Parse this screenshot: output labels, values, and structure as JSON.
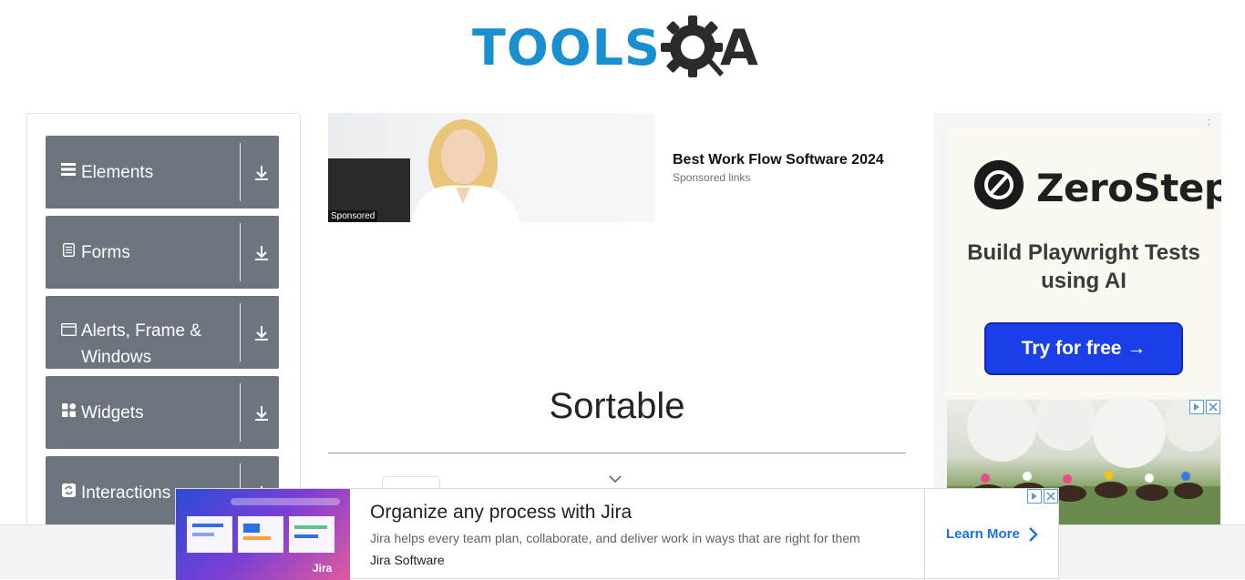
{
  "header": {
    "logo_text": "TOOLS",
    "logo_q_letter": "A",
    "logo_icon": "gear-magnifier-icon",
    "brand_color": "#1a8fd0"
  },
  "sidebar": {
    "groups": [
      {
        "label": "Elements",
        "icon": "hamburger-icon"
      },
      {
        "label": "Forms",
        "icon": "document-icon"
      },
      {
        "label": "Alerts, Frame & Windows",
        "icon": "window-icon"
      },
      {
        "label": "Widgets",
        "icon": "grid-icon"
      },
      {
        "label": "Interactions",
        "icon": "swap-icon"
      }
    ],
    "group_color": "#6c757d"
  },
  "ad_top": {
    "sponsored_tag": "Sponsored",
    "title": "Best Work Flow Software 2024",
    "subtitle": "Sponsored links"
  },
  "main": {
    "page_title": "Sortable"
  },
  "ad_right": {
    "brand": "ZeroStep",
    "tagline": "Build Playwright Tests using AI",
    "cta": "Try for free →",
    "cta_color": "#1a3fe8",
    "corner_marker": ":"
  },
  "ad_bottom": {
    "title": "Organize any process with Jira",
    "description": "Jira helps every team plan, collaborate, and deliver work in ways that are right for them",
    "brand": "Jira Software",
    "image_badge": "Jira",
    "cta": "Learn More",
    "cta_color": "#1a73e8"
  }
}
